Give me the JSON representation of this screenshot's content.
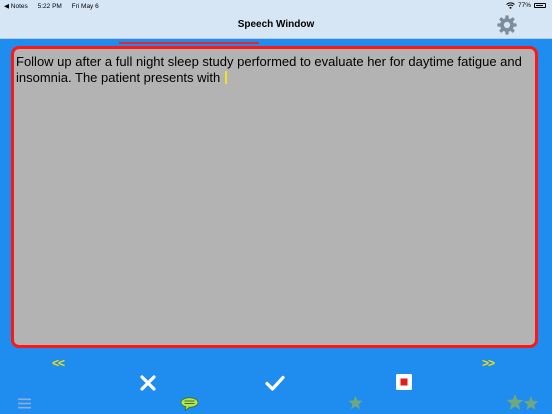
{
  "status_bar": {
    "back_app": "◀ Notes",
    "time": "5:22 PM",
    "date": "Fri May 6",
    "battery": "77%"
  },
  "nav": {
    "title": "Speech Window"
  },
  "dictation": {
    "text": "Follow up after a full night sleep study performed to evaluate her for daytime fatigue and insomnia. The patient presents with"
  },
  "controls": {
    "prev_label": "<<",
    "next_label": ">>"
  },
  "colors": {
    "background": "#1f8cf0",
    "nav_bar": "#d7e6f5",
    "text_area": "#b3b3b3",
    "text_area_border": "#ff1616",
    "arrows": "#f2e200",
    "icons": "#ffffff"
  },
  "icons": [
    "wifi-icon",
    "battery-icon",
    "gear-icon",
    "cancel-icon",
    "confirm-icon",
    "stop-icon",
    "menu-icon",
    "chat-icon",
    "star-icon",
    "double-star-icon"
  ]
}
